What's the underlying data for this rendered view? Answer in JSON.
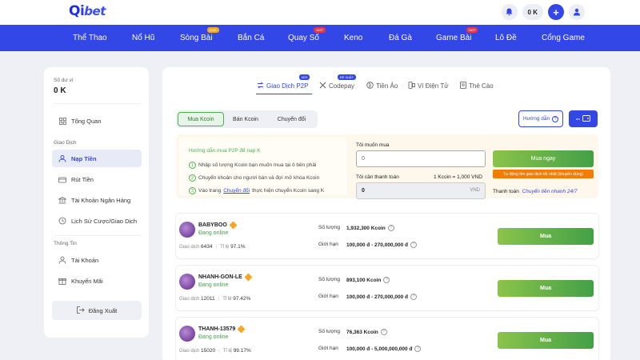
{
  "brand": {
    "logo_q": "Q",
    "logo_i": "i",
    "logo_bet": "bet",
    "accent": "#3346e6",
    "green": "#43a047"
  },
  "header": {
    "balance": "0 K"
  },
  "nav": [
    {
      "label": "Thể Thao",
      "badge": ""
    },
    {
      "label": "Nổ Hũ",
      "badge": ""
    },
    {
      "label": "Sòng Bài",
      "badge": "LIVE"
    },
    {
      "label": "Bắn Cá",
      "badge": ""
    },
    {
      "label": "Quay Số",
      "badge": "HOT"
    },
    {
      "label": "Keno",
      "badge": ""
    },
    {
      "label": "Đá Gà",
      "badge": ""
    },
    {
      "label": "Game Bài",
      "badge": "HOT"
    },
    {
      "label": "Lô Đề",
      "badge": ""
    },
    {
      "label": "Cổng Game",
      "badge": ""
    }
  ],
  "sidebar": {
    "balance_label": "Số dư ví",
    "balance_value": "0 K",
    "overview": "Tổng Quan",
    "section_transactions": "Giao Dịch",
    "items": [
      {
        "label": "Nạp Tiền",
        "icon": "deposit-icon"
      },
      {
        "label": "Rút Tiền",
        "icon": "withdraw-icon"
      },
      {
        "label": "Tài Khoản Ngân Hàng",
        "icon": "bank-icon"
      },
      {
        "label": "Lịch Sử Cược/Giao Dịch",
        "icon": "history-icon"
      }
    ],
    "section_info": "Thông Tin",
    "info_items": [
      {
        "label": "Tài Khoản",
        "icon": "user-icon"
      },
      {
        "label": "Khuyến Mãi",
        "icon": "gift-icon"
      }
    ],
    "logout": "Đăng Xuất"
  },
  "tabs": [
    {
      "label": "Giao Dịch P2P",
      "badge": "MỚI"
    },
    {
      "label": "Codepay",
      "badge": "ĐỀ XUẤT"
    },
    {
      "label": "Tiền Ảo",
      "badge": ""
    },
    {
      "label": "Ví Điện Tử",
      "badge": ""
    },
    {
      "label": "Thẻ Cào",
      "badge": ""
    }
  ],
  "segments": [
    "Mua Kcoin",
    "Bán Kcoin",
    "Chuyển đổi"
  ],
  "guide_button": "Hướng dẫn",
  "wallet_button": "--",
  "guide": {
    "title": "Hướng dẫn mua P2P để nạp K",
    "steps": [
      {
        "num": "1",
        "text": "Nhập số lượng Kcoin bạn muốn mua tại ô bên phải"
      },
      {
        "num": "2",
        "text": "Chuyển khoản cho người bán và đợi mở khóa Kcoin"
      },
      {
        "num": "3",
        "pre": "Vào trang ",
        "link": "Chuyển đổi",
        "post": " thực hiện chuyển Kcoin sang K"
      }
    ]
  },
  "buy_form": {
    "want_label": "Tôi muốn mua",
    "want_value": "0",
    "pay_label": "Tôi cần thanh toán",
    "rate": "1 Kcoin = 1,000 VND",
    "pay_value": "0",
    "pay_unit": "VND",
    "buy_now": "Mua ngay",
    "promo": "Tự động tìm giao dịch tốt nhất (khuyến dùng)",
    "payment_label": "Thanh toán",
    "payment_fast": "Chuyển tiền nhanh 24/7"
  },
  "sellers": [
    {
      "name": "BABYBOO",
      "status": "Đang online",
      "trades_label": "Giao dịch",
      "trades": "6434",
      "rate_label": "Tỉ lệ",
      "rate": "97.1%",
      "qty_label": "Số lượng",
      "qty": "1,932,300 Kcoin",
      "limit_label": "Giới hạn",
      "limit": "100,000 đ - 270,000,000 đ",
      "button": "Mua"
    },
    {
      "name": "NHANH-GON-LE",
      "status": "Đang online",
      "trades_label": "Giao dịch",
      "trades": "12011",
      "rate_label": "Tỉ lệ",
      "rate": "97.42%",
      "qty_label": "Số lượng",
      "qty": "893,100 Kcoin",
      "limit_label": "Giới hạn",
      "limit": "100,000 đ - 270,000,000 đ",
      "button": "Mua"
    },
    {
      "name": "THANH-13579",
      "status": "Đang online",
      "trades_label": "Giao dịch",
      "trades": "15020",
      "rate_label": "Tỉ lệ",
      "rate": "99.17%",
      "qty_label": "Số lượng",
      "qty": "76,363 Kcoin",
      "limit_label": "Giới hạn",
      "limit": "100,000 đ - 5,000,000,000 đ",
      "button": "Mua"
    }
  ]
}
